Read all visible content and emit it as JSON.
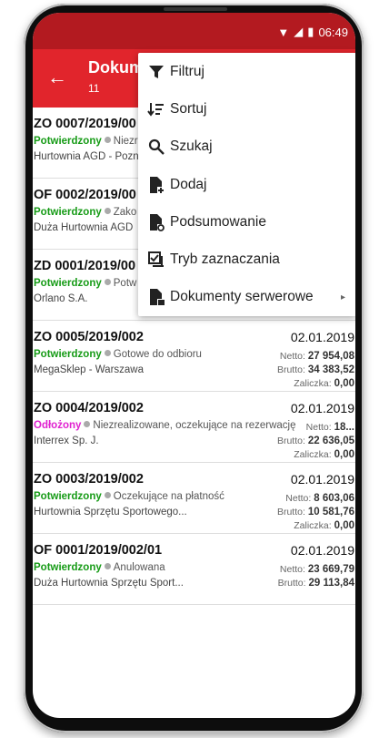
{
  "statusbar": {
    "time": "06:49"
  },
  "appbar": {
    "title": "Dokum",
    "count": "11"
  },
  "menu": [
    {
      "label": "Filtruj",
      "icon": "filter-icon"
    },
    {
      "label": "Sortuj",
      "icon": "sort-icon"
    },
    {
      "label": "Szukaj",
      "icon": "search-icon"
    },
    {
      "label": "Dodaj",
      "icon": "add-document-icon"
    },
    {
      "label": "Podsumowanie",
      "icon": "summary-document-icon"
    },
    {
      "label": "Tryb zaznaczania",
      "icon": "checkbox-list-icon"
    },
    {
      "label": "Dokumenty serwerowe",
      "icon": "server-document-icon",
      "submenu": "▸"
    }
  ],
  "documents": [
    {
      "number": "ZO 0007/2019/00",
      "status": "Potwierdzony",
      "status_color": "#169b16",
      "desc": "Niezre",
      "client": "Hurtownia AGD - Pozn",
      "date": "",
      "netto": "",
      "brutto": "",
      "zal": ""
    },
    {
      "number": "OF 0002/2019/00",
      "status": "Potwierdzony",
      "status_color": "#169b16",
      "desc": "Zako",
      "client": "Duża Hurtownia AGD",
      "date": "",
      "netto": "",
      "brutto": "",
      "zal": ""
    },
    {
      "number": "ZD 0001/2019/00",
      "status": "Potwierdzony",
      "status_color": "#169b16",
      "desc": "Potw",
      "client": "Orlano S.A.",
      "date": "",
      "netto": "",
      "brutto": "",
      "zal": ""
    },
    {
      "number": "ZO 0005/2019/002",
      "status": "Potwierdzony",
      "status_color": "#169b16",
      "desc": "Gotowe do odbioru",
      "client": "MegaSklep - Warszawa",
      "date": "02.01.2019",
      "netto": "27 954,08",
      "brutto": "34 383,52",
      "zal": "0,00"
    },
    {
      "number": "ZO 0004/2019/002",
      "status": "Odłożony",
      "status_color": "#e020d0",
      "desc": "Niezrealizowane, oczekujące na rezerwację",
      "client": "Interrex Sp. J.",
      "date": "02.01.2019",
      "netto": "18...",
      "brutto": "22 636,05",
      "zal": "0,00"
    },
    {
      "number": "ZO 0003/2019/002",
      "status": "Potwierdzony",
      "status_color": "#169b16",
      "desc": "Oczekujące na płatność",
      "client": "Hurtownia Sprzętu Sportowego...",
      "date": "02.01.2019",
      "netto": "8 603,06",
      "brutto": "10 581,76",
      "zal": "0,00"
    },
    {
      "number": "OF 0001/2019/002/01",
      "status": "Potwierdzony",
      "status_color": "#169b16",
      "desc": "Anulowana",
      "client": "Duża Hurtownia Sprzętu Sport...",
      "date": "02.01.2019",
      "netto": "23 669,79",
      "brutto": "29 113,84",
      "zal": ""
    }
  ],
  "labels": {
    "netto": "Netto: ",
    "brutto": "Brutto: ",
    "zal": "Zaliczka: "
  }
}
